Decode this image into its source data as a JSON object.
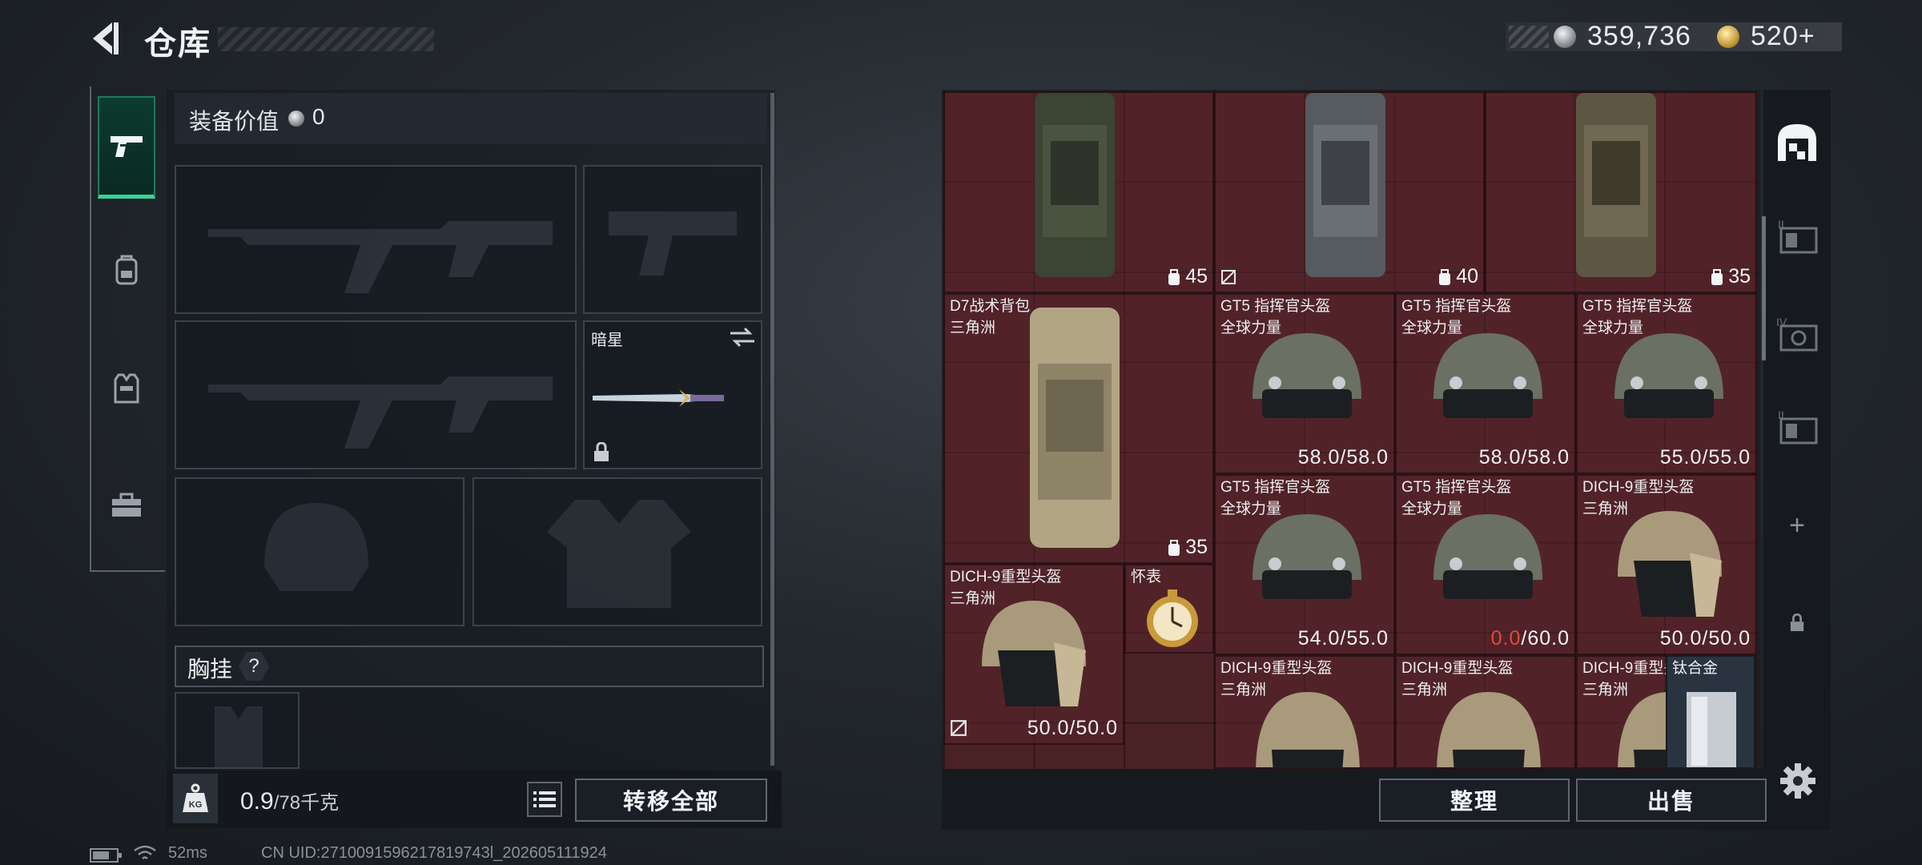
{
  "header": {
    "title": "仓库",
    "currency_silver": "359,736",
    "currency_gold": "520+",
    "colors": {
      "accent": "#36d399",
      "grid_bg": "#4a2226",
      "warn_red": "#e8463c"
    }
  },
  "left_tabs": [
    {
      "icon": "pistol-icon",
      "active": true
    },
    {
      "icon": "backpack-icon",
      "active": false
    },
    {
      "icon": "vest-icon",
      "active": false
    },
    {
      "icon": "toolbox-icon",
      "active": false
    }
  ],
  "equipment": {
    "value_label": "装备价值",
    "value": "0",
    "melee_name": "暗星",
    "chest_label": "胸挂",
    "chest_help": "?",
    "weight_value": "0.9",
    "weight_unit": "/78千克",
    "kg_icon_text": "KG",
    "transfer_all_label": "转移全部"
  },
  "warehouse": {
    "items": [
      {
        "id": "bag1",
        "name": "",
        "sub": "",
        "capacity": "45",
        "kind": "backpack"
      },
      {
        "id": "bag2",
        "name": "",
        "sub": "",
        "capacity": "40",
        "kind": "backpack"
      },
      {
        "id": "bag3",
        "name": "",
        "sub": "",
        "capacity": "35",
        "kind": "backpack"
      },
      {
        "id": "d7",
        "name": "D7战术背包",
        "sub": "三角洲",
        "capacity": "35",
        "kind": "backpack"
      },
      {
        "id": "gt5a",
        "name": "GT5 指挥官头盔",
        "sub": "全球力量",
        "durability": "58.0/58.0"
      },
      {
        "id": "gt5b",
        "name": "GT5 指挥官头盔",
        "sub": "全球力量",
        "durability": "58.0/58.0"
      },
      {
        "id": "gt5c",
        "name": "GT5 指挥官头盔",
        "sub": "全球力量",
        "durability": "55.0/55.0"
      },
      {
        "id": "gt5d",
        "name": "GT5 指挥官头盔",
        "sub": "全球力量",
        "durability": "54.0/55.0"
      },
      {
        "id": "gt5e",
        "name": "GT5 指挥官头盔",
        "sub": "全球力量",
        "durability_red": "0.0",
        "durability_rest": "/60.0"
      },
      {
        "id": "dich1",
        "name": "DICH-9重型头盔",
        "sub": "三角洲",
        "durability": "50.0/50.0"
      },
      {
        "id": "dich2",
        "name": "DICH-9重型头盔",
        "sub": "三角洲",
        "durability": "50.0/50.0"
      },
      {
        "id": "watch",
        "name": "怀表",
        "sub": ""
      },
      {
        "id": "dich3",
        "name": "DICH-9重型头盔",
        "sub": "三角洲"
      },
      {
        "id": "dich4",
        "name": "DICH-9重型头盔",
        "sub": "三角洲"
      },
      {
        "id": "dich5",
        "name": "DICH-9重型头盔",
        "sub": "三角洲"
      },
      {
        "id": "ti",
        "name": "钛合金",
        "sub": ""
      }
    ],
    "organize_label": "整理",
    "sell_label": "出售"
  },
  "right_sidebar": [
    {
      "icon": "warehouse-icon",
      "label": ""
    },
    {
      "icon": "extension-box-icon",
      "label": "II"
    },
    {
      "icon": "extension-box-icon",
      "label": "IV"
    },
    {
      "icon": "extension-box-icon",
      "label": "II"
    },
    {
      "icon": "plus-icon",
      "label": "+"
    },
    {
      "icon": "lock-icon",
      "label": ""
    }
  ],
  "status_bar": {
    "ping": "52ms",
    "uid": "CN UID:2710091596217819743l_202605111924"
  }
}
